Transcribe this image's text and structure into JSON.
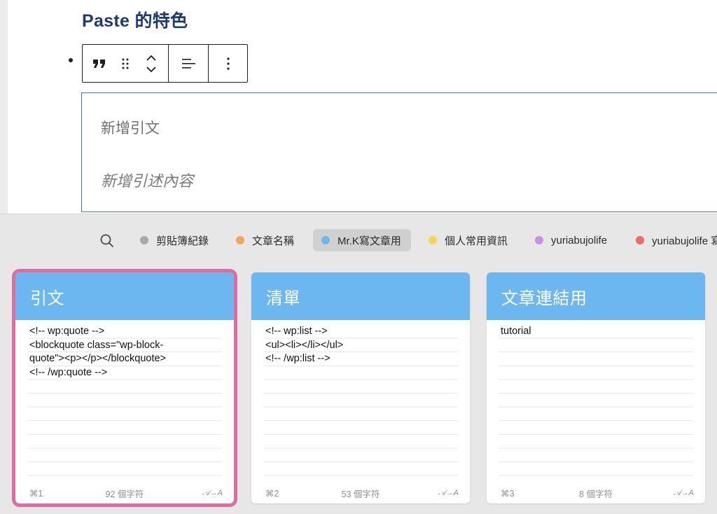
{
  "editor": {
    "heading": "Paste 的特色",
    "quote_placeholder": "新增引文",
    "citation_placeholder": "新增引述內容"
  },
  "pinboards": [
    {
      "label": "剪貼簿紀錄",
      "color": "#a8a8a8",
      "active": false
    },
    {
      "label": "文章名稱",
      "color": "#f1a65a",
      "active": false
    },
    {
      "label": "Mr.K寫文章用",
      "color": "#6cb7ef",
      "active": true
    },
    {
      "label": "個人常用資訊",
      "color": "#f6d35b",
      "active": false
    },
    {
      "label": "yuriabujolife",
      "color": "#c98fe0",
      "active": false
    },
    {
      "label": "yuriabujolife 寫",
      "color": "#ee6a63",
      "active": false
    }
  ],
  "cards": [
    {
      "title": "引文",
      "content": "<!-- wp:quote -->\n<blockquote class=\"wp-block-\nquote\"><p></p></blockquote>\n<!-- /wp:quote -->",
      "shortcut": "⌘1",
      "count": "92 個字符",
      "transform": "𝒜→A"
    },
    {
      "title": "清單",
      "content": "<!-- wp:list -->\n<ul><li></li></ul>\n<!-- /wp:list -->",
      "shortcut": "⌘2",
      "count": "53 個字符",
      "transform": "𝒜→A"
    },
    {
      "title": "文章連結用",
      "content": "tutorial",
      "shortcut": "⌘3",
      "count": "8 個字符",
      "transform": "𝒜→A"
    }
  ]
}
